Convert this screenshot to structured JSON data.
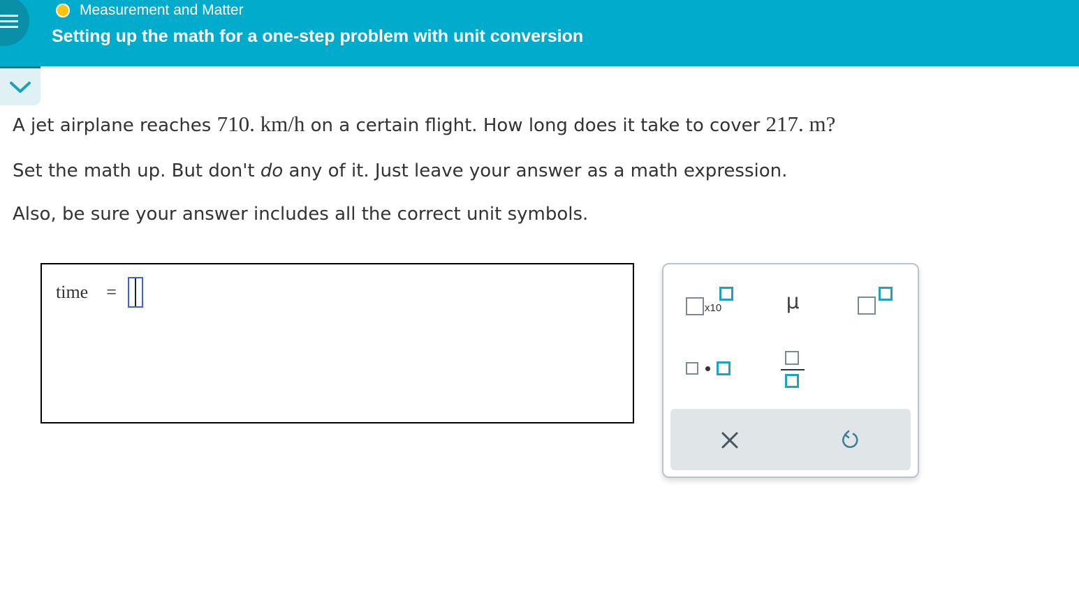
{
  "header": {
    "topic": "Measurement and Matter",
    "title": "Setting up the math for a one-step problem with unit conversion",
    "topic_status_color": "#ffc20e",
    "bar_color": "#00abcb"
  },
  "question": {
    "line1_a": "A jet airplane reaches ",
    "speed_value": "710.",
    "speed_unit": "km/h",
    "line1_b": " on a certain flight. How long does it take to cover ",
    "distance_value": "217.",
    "distance_unit": "m",
    "line1_c": "?",
    "line2_a": "Set the math up. But don't ",
    "line2_em": "do",
    "line2_b": " any of it. Just leave your answer as a math expression.",
    "line3": "Also, be sure your answer includes all the correct unit symbols."
  },
  "answer": {
    "label": "time",
    "equals": "="
  },
  "keypad": {
    "sci_notation_label": "x10",
    "mu_symbol": "µ",
    "clear_symbol": "×",
    "keys": [
      "scientific-notation",
      "micro-prefix",
      "superscript",
      "multiply-dot",
      "fraction",
      "clear",
      "undo"
    ]
  }
}
